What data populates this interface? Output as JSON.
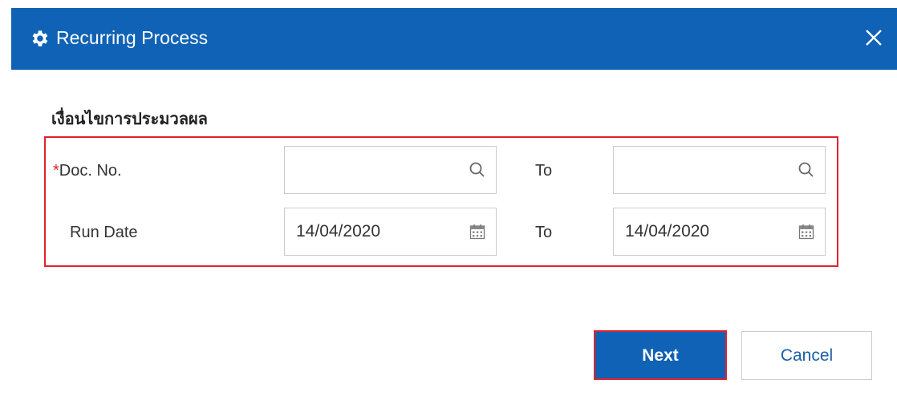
{
  "dialog": {
    "title": "Recurring Process",
    "title_icon": "gear-icon",
    "close_icon": "close-icon"
  },
  "criteria": {
    "section_title": "เงื่อนไขการประมวลผล",
    "doc_no": {
      "required_mark": "*",
      "label": "Doc. No.",
      "from_value": "",
      "to_label": "To",
      "to_value": "",
      "icon": "search-icon"
    },
    "run_date": {
      "label": "Run Date",
      "from_value": "14/04/2020",
      "to_label": "To",
      "to_value": "14/04/2020",
      "icon": "calendar-icon"
    }
  },
  "buttons": {
    "next_label": "Next",
    "cancel_label": "Cancel"
  },
  "colors": {
    "header": "#0f62b5",
    "highlight": "#e2222b",
    "required": "#e2222b"
  }
}
